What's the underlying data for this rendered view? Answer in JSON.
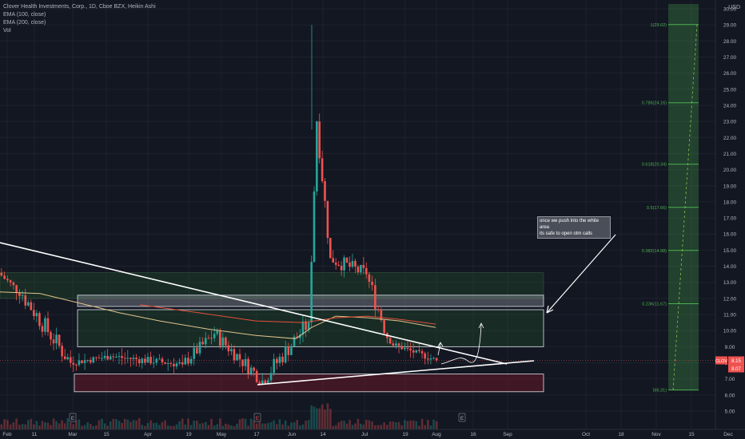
{
  "legend": {
    "title": "Clover Health Investments, Corp., 1D, Cboe BZX, Heikin Ashi",
    "ema100": "EMA (100, close)",
    "ema200": "EMA (200, close)",
    "vol": "Vol"
  },
  "currency": "USD",
  "note": {
    "line1": "once we push into the white area",
    "line2": "its safe to open otm calls"
  },
  "price_badges": {
    "ticker": "CLOV",
    "last": "8.15",
    "second": "8.07"
  },
  "earnings_markers": [
    "E",
    "E",
    "E"
  ],
  "fib_levels": [
    {
      "label": "1(29.02)",
      "price": 29.02
    },
    {
      "label": "0.786(24.16)",
      "price": 24.16
    },
    {
      "label": "0.618(20.34)",
      "price": 20.34
    },
    {
      "label": "0.5(17.66)",
      "price": 17.66
    },
    {
      "label": "0.382(14.98)",
      "price": 14.98
    },
    {
      "label": "0.236(11.67)",
      "price": 11.67
    },
    {
      "label": "0(6.31)",
      "price": 6.31
    }
  ],
  "colors": {
    "up": "#26a69a",
    "down": "#ef5350",
    "ema100": "#e0c38c",
    "ema200": "#e84e3c",
    "fib": "#4caf50"
  },
  "chart_data": {
    "type": "candlestick",
    "title": "Clover Health Investments, Corp., 1D, Cboe BZX, Heikin Ashi",
    "y_ticks": [
      5.0,
      6.0,
      7.0,
      8.0,
      9.0,
      10.0,
      11.0,
      12.0,
      13.0,
      14.0,
      15.0,
      16.0,
      17.0,
      18.0,
      19.0,
      20.0,
      21.0,
      22.0,
      23.0,
      24.0,
      25.0,
      26.0,
      27.0,
      28.0,
      29.0,
      30.0
    ],
    "y_tick_labels": [
      "5.00",
      "6.00",
      "7.00",
      "8.00",
      "9.00",
      "10.00",
      "11.00",
      "12.00",
      "13.00",
      "14.00",
      "15.00",
      "16.00",
      "17.00",
      "18.00",
      "19.00",
      "20.00",
      "21.00",
      "22.00",
      "23.00",
      "24.00",
      "25.00",
      "26.00",
      "27.00",
      "28.00",
      "29.00",
      "30.00"
    ],
    "x_ticks": [
      "Feb",
      "11",
      "Mar",
      "15",
      "Apr",
      "19",
      "May",
      "17",
      "Jun",
      "14",
      "Jul",
      "19",
      "Aug",
      "16",
      "Sep",
      "Oct",
      "18",
      "Nov",
      "15",
      "Dec"
    ],
    "ylim": [
      5.0,
      30.3
    ],
    "last_price": 8.15,
    "periods": [
      {
        "label": "Feb",
        "start": 0,
        "end": 30,
        "o": 13.6,
        "c": 12.2,
        "h": 14.0,
        "l": 11.6
      },
      {
        "label": "Feb-Mar",
        "start": 30,
        "end": 90,
        "o": 12.2,
        "c": 8.0,
        "h": 12.6,
        "l": 7.4
      },
      {
        "label": "Mar",
        "start": 90,
        "end": 140,
        "o": 8.0,
        "c": 8.4,
        "h": 8.9,
        "l": 7.3
      },
      {
        "label": "Mar-Apr",
        "start": 140,
        "end": 230,
        "o": 8.4,
        "c": 7.9,
        "h": 9.2,
        "l": 7.2
      },
      {
        "label": "Apr-May",
        "start": 230,
        "end": 270,
        "o": 7.9,
        "c": 9.8,
        "h": 11.0,
        "l": 7.8
      },
      {
        "label": "May",
        "start": 270,
        "end": 330,
        "o": 9.8,
        "c": 6.9,
        "h": 10.2,
        "l": 6.6
      },
      {
        "label": "May-Jun",
        "start": 330,
        "end": 388,
        "o": 6.9,
        "c": 10.5,
        "h": 11.2,
        "l": 6.7
      },
      {
        "label": "Jun",
        "start": 388,
        "end": 398,
        "o": 10.5,
        "c": 23.0,
        "h": 29.0,
        "l": 10.0
      },
      {
        "label": "Jun",
        "start": 398,
        "end": 415,
        "o": 23.0,
        "c": 14.5,
        "h": 24.5,
        "l": 13.8
      },
      {
        "label": "Jun-Jul",
        "start": 415,
        "end": 460,
        "o": 14.5,
        "c": 13.5,
        "h": 15.8,
        "l": 12.0
      },
      {
        "label": "Jul",
        "start": 460,
        "end": 490,
        "o": 13.5,
        "c": 9.2,
        "h": 13.8,
        "l": 8.9
      },
      {
        "label": "Jul-Aug",
        "start": 490,
        "end": 548,
        "o": 9.2,
        "c": 8.15,
        "h": 9.4,
        "l": 7.9
      }
    ],
    "ema100": [
      [
        0,
        12.4
      ],
      [
        50,
        12.3
      ],
      [
        100,
        11.7
      ],
      [
        150,
        11.1
      ],
      [
        200,
        10.6
      ],
      [
        260,
        10.1
      ],
      [
        320,
        9.7
      ],
      [
        370,
        9.5
      ],
      [
        390,
        10.2
      ],
      [
        420,
        10.9
      ],
      [
        460,
        10.8
      ],
      [
        500,
        10.6
      ],
      [
        545,
        10.2
      ]
    ],
    "ema200": [
      [
        175,
        11.6
      ],
      [
        250,
        11.1
      ],
      [
        320,
        10.6
      ],
      [
        380,
        10.5
      ],
      [
        420,
        10.8
      ],
      [
        460,
        10.9
      ],
      [
        500,
        10.7
      ],
      [
        545,
        10.4
      ]
    ],
    "zones": [
      {
        "name": "upper-green",
        "x0": 0,
        "x1": 680,
        "y0": 12.0,
        "y1": 13.6
      },
      {
        "name": "white-box",
        "x0": 97,
        "x1": 680,
        "y0": 11.5,
        "y1": 12.2
      },
      {
        "name": "mid-green",
        "x0": 97,
        "x1": 680,
        "y0": 9.0,
        "y1": 11.3
      },
      {
        "name": "red-box",
        "x0": 93,
        "x1": 680,
        "y0": 6.2,
        "y1": 7.3
      }
    ],
    "fib_x": [
      836,
      874
    ],
    "fib_start_price": 6.31,
    "fib_end_price": 29.02
  }
}
